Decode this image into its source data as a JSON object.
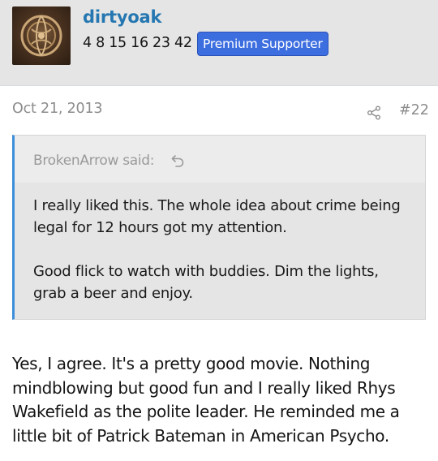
{
  "user": {
    "name": "dirtyoak",
    "title": "4 8 15 16 23 42",
    "badge": "Premium Supporter"
  },
  "post": {
    "date": "Oct 21, 2013",
    "number": "#22",
    "quote": {
      "author_line": "BrokenArrow said:",
      "paragraphs": [
        "I really liked this. The whole idea about crime being legal for 12 hours got my attention.",
        "Good flick to watch with buddies. Dim the lights, grab a beer and enjoy."
      ]
    },
    "body": "Yes, I agree. It's a pretty good movie. Nothing mindblowing but good fun and I really liked Rhys Wakefield as the polite leader. He reminded me a little bit of Patrick Bateman in American Psycho."
  },
  "colors": {
    "username": "#2577b1",
    "badge_bg": "#3d6ee0",
    "quote_border": "#3d8fdb",
    "header_bg": "#e5e5e5"
  },
  "icons": {
    "share": "share-icon",
    "quote_jump": "arrow-up-left-icon"
  }
}
